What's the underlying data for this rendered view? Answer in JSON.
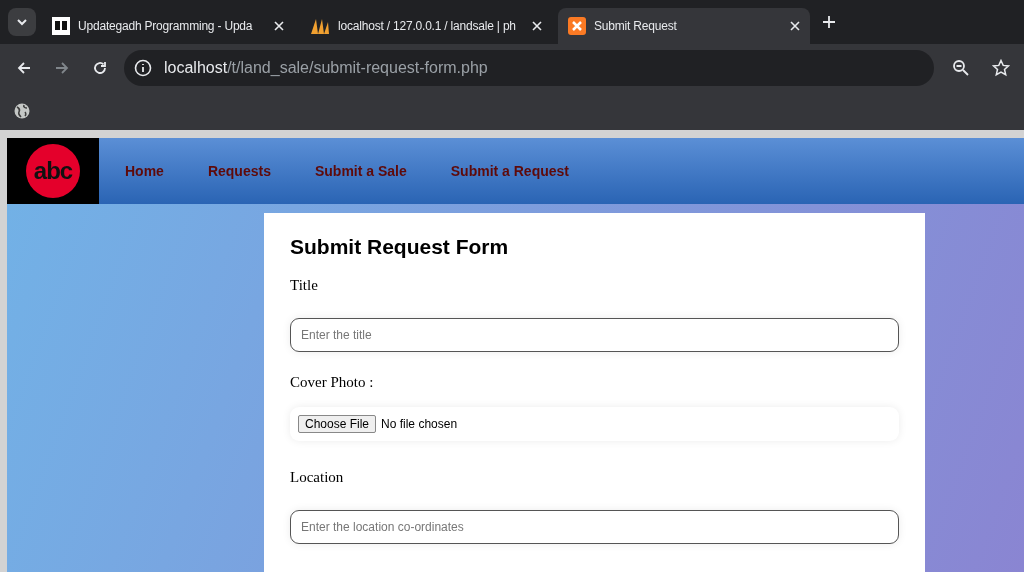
{
  "browser": {
    "tabs": [
      {
        "title": "Updategadh Programming - Upda",
        "selected": false
      },
      {
        "title": "localhost / 127.0.0.1 / landsale | ph",
        "selected": false
      },
      {
        "title": "Submit Request",
        "selected": true
      }
    ],
    "url_host": "localhost",
    "url_path": "/t/land_sale/submit-request-form.php"
  },
  "nav": {
    "logo": "abc",
    "links": [
      "Home",
      "Requests",
      "Submit a Sale",
      "Submit a Request"
    ]
  },
  "form": {
    "heading": "Submit Request Form",
    "fields": [
      {
        "kind": "text",
        "label": "Title",
        "placeholder": "Enter the title"
      },
      {
        "kind": "file",
        "label": "Cover Photo :",
        "button": "Choose File",
        "status": "No file chosen"
      },
      {
        "kind": "text",
        "label": "Location",
        "placeholder": "Enter the location co-ordinates"
      }
    ]
  }
}
